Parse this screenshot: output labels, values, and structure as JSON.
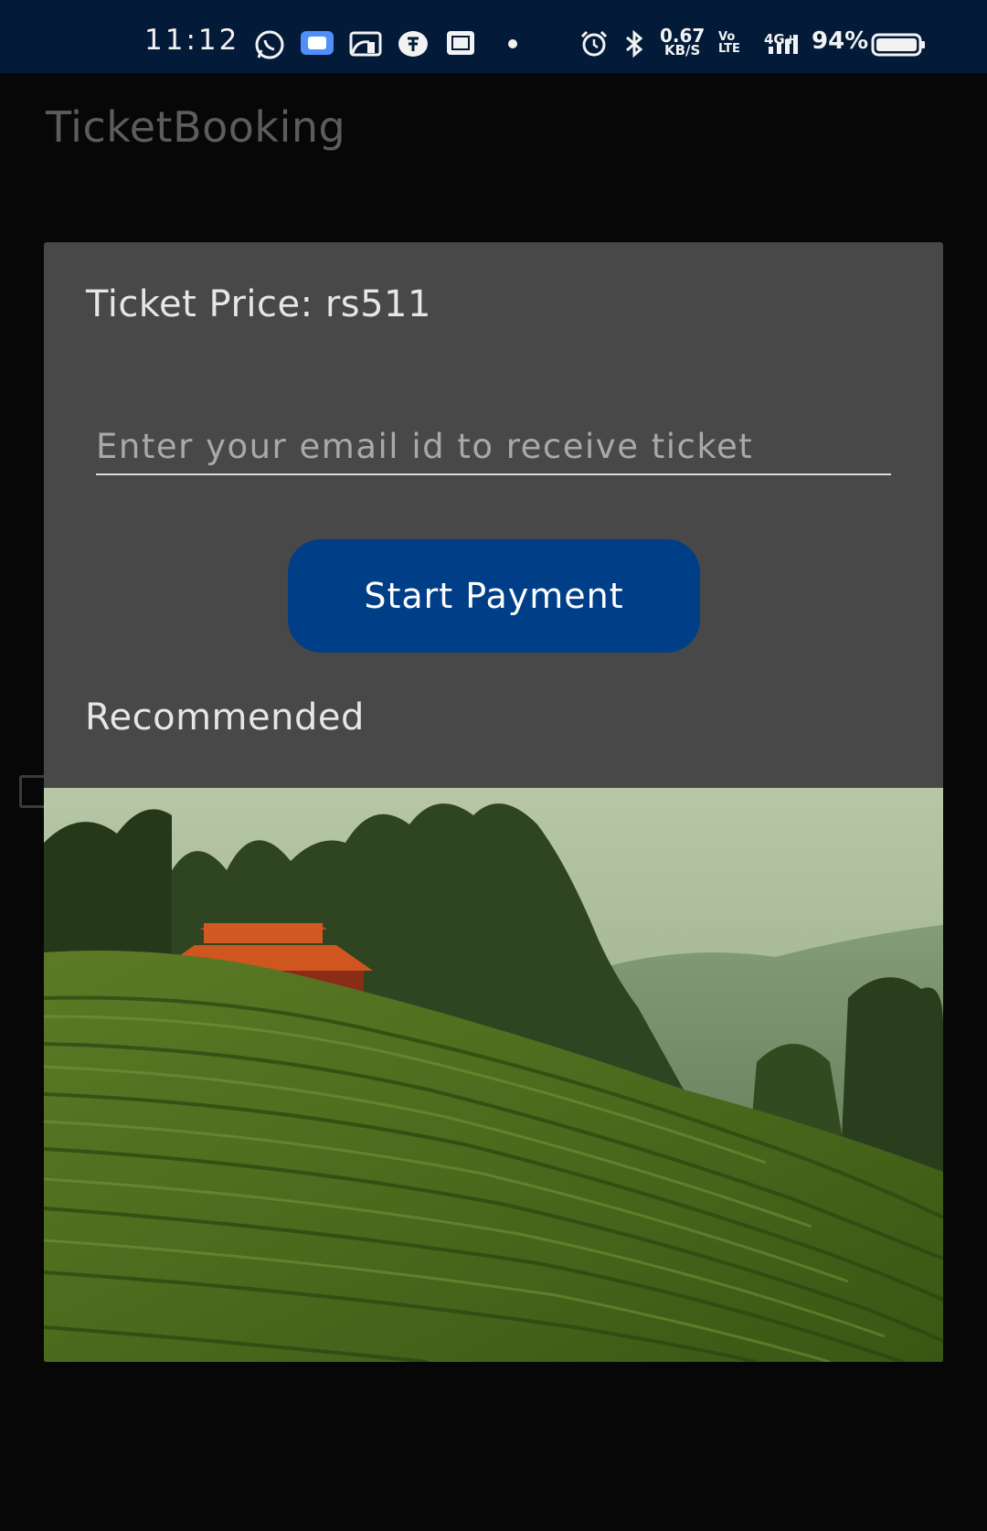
{
  "status_bar": {
    "time": "11:12",
    "net_speed_value": "0.67",
    "net_speed_unit": "KB/S",
    "volte_top": "Vo",
    "volte_bottom": "LTE",
    "network": "4G+",
    "battery": "94%"
  },
  "app": {
    "title": "TicketBooking"
  },
  "dialog": {
    "price_label": "Ticket Price: rs511",
    "email_placeholder": "Enter your email id to receive ticket",
    "email_value": "",
    "pay_button_label": "Start Payment",
    "recommended_label": "Recommended"
  },
  "colors": {
    "status_bar_bg": "#031a38",
    "background": "#070707",
    "dialog_bg": "#484848",
    "button_bg": "#003f88"
  }
}
